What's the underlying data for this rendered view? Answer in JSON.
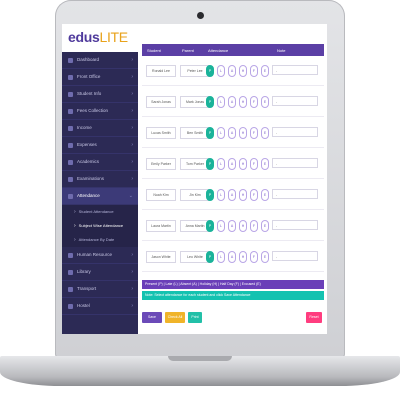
{
  "brand": {
    "logo_main": "edus",
    "logo_accent": "LITE",
    "accent_color": "#5b3fa5",
    "sidebar_color": "#2c2a55"
  },
  "sidebar": {
    "items": [
      {
        "label": "Dashboard",
        "icon": "home-icon"
      },
      {
        "label": "Front Office",
        "icon": "building-icon"
      },
      {
        "label": "Student Info",
        "icon": "user-icon"
      },
      {
        "label": "Fees Collection",
        "icon": "money-icon"
      },
      {
        "label": "Income",
        "icon": "chart-icon"
      },
      {
        "label": "Expenses",
        "icon": "wallet-icon"
      },
      {
        "label": "Academics",
        "icon": "book-icon"
      },
      {
        "label": "Examinations",
        "icon": "exam-icon"
      },
      {
        "label": "Attendance",
        "icon": "calendar-icon"
      }
    ],
    "sub_items": [
      {
        "label": "Student Attendance"
      },
      {
        "label": "Subject Wise Attendance"
      },
      {
        "label": "Attendance By Date"
      }
    ],
    "items_after": [
      {
        "label": "Human Resource",
        "icon": "people-icon"
      },
      {
        "label": "Library",
        "icon": "library-icon"
      },
      {
        "label": "Transport",
        "icon": "bus-icon"
      },
      {
        "label": "Hostel",
        "icon": "bed-icon"
      }
    ]
  },
  "table": {
    "headers": [
      "Student",
      "Parent",
      "Attendance",
      "Note"
    ],
    "options": [
      "P",
      "L",
      "A",
      "H",
      "F",
      "E"
    ],
    "rows": [
      {
        "name": "Ronald Lee",
        "parent": "Peter Lee",
        "selected": 0,
        "note": "-"
      },
      {
        "name": "Sarah Jonas",
        "parent": "Mark Jonas",
        "selected": 0,
        "note": "-"
      },
      {
        "name": "Lucas Smith",
        "parent": "Ben Smith",
        "selected": 0,
        "note": "-"
      },
      {
        "name": "Emily Parker",
        "parent": "Tom Parker",
        "selected": 0,
        "note": "-"
      },
      {
        "name": "Noah Kim",
        "parent": "Jin Kim",
        "selected": 0,
        "note": "-"
      },
      {
        "name": "Laura Martin",
        "parent": "Anna Martin",
        "selected": 0,
        "note": "-"
      },
      {
        "name": "Jason White",
        "parent": "Leo White",
        "selected": 0,
        "note": "-"
      }
    ]
  },
  "legend": {
    "purple": "Present (P) | Late (L) | Absent (A) | Holiday (H) | Half Day (F) | Excused (E)",
    "teal": "Note: Select attendance for each student and click Save Attendance"
  },
  "buttons": {
    "save": "Save Attendance",
    "check": "Check All",
    "print": "Print",
    "reset": "Reset"
  }
}
